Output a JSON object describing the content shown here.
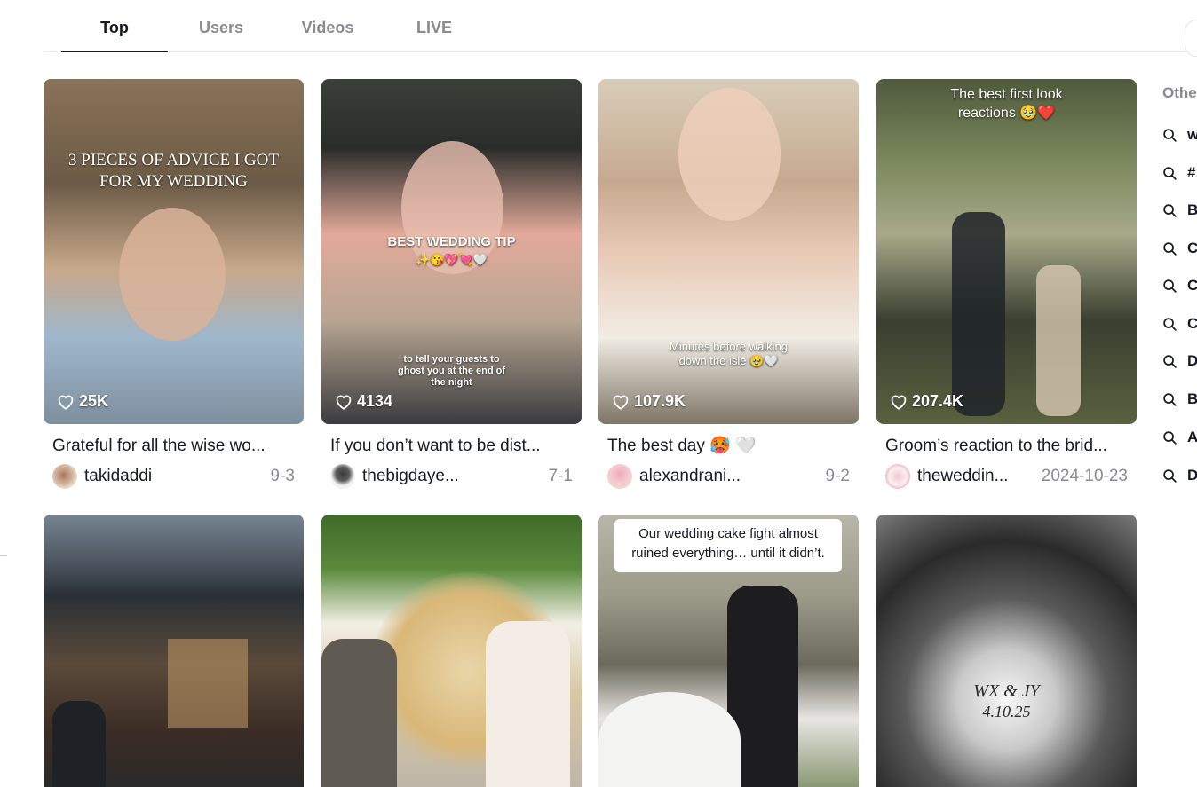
{
  "tabs": [
    {
      "label": "Top",
      "active": true
    },
    {
      "label": "Users",
      "active": false
    },
    {
      "label": "Videos",
      "active": false
    },
    {
      "label": "LIVE",
      "active": false
    }
  ],
  "videos": [
    {
      "overlay_text": "3 PIECES OF ADVICE I GOT FOR MY WEDDING",
      "likes": "25K",
      "description": "Grateful for all the wise wo...",
      "username": "takidaddi",
      "date": "9-3"
    },
    {
      "overlay_text": "BEST WEDDING TIP",
      "overlay_emoji": "✨😘💖💘🤍",
      "overlay_caption": "to tell your guests to ghost you at the end of the night",
      "likes": "4134",
      "description": "If you don’t want to be dist...",
      "username": "thebigdaye...",
      "date": "7-1"
    },
    {
      "overlay_caption": "Minutes before walking down the isle 🥹🤍",
      "likes": "107.9K",
      "description": "The best day 🥵 🤍",
      "username": "alexandrani...",
      "date": "9-2"
    },
    {
      "overlay_text": "The best first look reactions 🥹❤️",
      "likes": "207.4K",
      "description": "Groom’s reaction to the brid...",
      "username": "theweddin...",
      "date": "2024-10-23"
    },
    {},
    {},
    {
      "overlay_text": "Our wedding cake fight almost ruined everything… until it didn’t."
    },
    {
      "overlay_text": "WX & JY",
      "overlay_subtext": "4.10.25"
    }
  ],
  "sidebar": {
    "title": "Othe",
    "items": [
      "w",
      "#",
      "B",
      "C",
      "C",
      "C",
      "D",
      "B",
      "A",
      "D"
    ]
  },
  "colors": {
    "text_primary": "#161823",
    "text_secondary": "#8a8b91",
    "divider": "#ececec"
  }
}
